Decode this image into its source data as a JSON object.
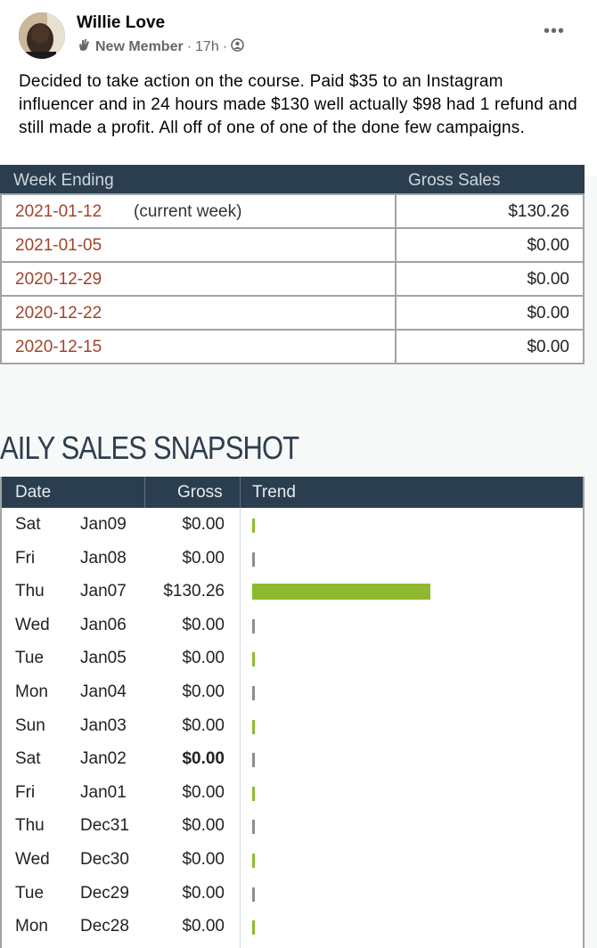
{
  "post": {
    "author": "Willie Love",
    "badge": "New Member",
    "time": "17h",
    "separator": "·",
    "more_label": "•••",
    "text": "Decided to take action on the course. Paid $35 to an Instagram influencer and in 24 hours made $130 well actually $98 had 1 refund and still made a profit. All off of one of one of the done few campaigns."
  },
  "weekly": {
    "headers": [
      "Week Ending",
      "Gross Sales"
    ],
    "rows": [
      {
        "date": "2021-01-12",
        "note": "(current week)",
        "value": "$130.26"
      },
      {
        "date": "2021-01-05",
        "note": "",
        "value": "$0.00"
      },
      {
        "date": "2020-12-29",
        "note": "",
        "value": "$0.00"
      },
      {
        "date": "2020-12-22",
        "note": "",
        "value": "$0.00"
      },
      {
        "date": "2020-12-15",
        "note": "",
        "value": "$0.00"
      }
    ]
  },
  "daily": {
    "title": "AILY SALES SNAPSHOT",
    "headers": [
      "Date",
      "Gross",
      "Trend"
    ],
    "max_value": 130.26,
    "rows": [
      {
        "day": "Sat",
        "date": "Jan09",
        "gross": "$0.00",
        "value": 0,
        "color": "#8fba2f"
      },
      {
        "day": "Fri",
        "date": "Jan08",
        "gross": "$0.00",
        "value": 0,
        "color": "#8e8e8e"
      },
      {
        "day": "Thu",
        "date": "Jan07",
        "gross": "$130.26",
        "value": 130.26,
        "color": "#8fba2f"
      },
      {
        "day": "Wed",
        "date": "Jan06",
        "gross": "$0.00",
        "value": 0,
        "color": "#8e8e8e"
      },
      {
        "day": "Tue",
        "date": "Jan05",
        "gross": "$0.00",
        "value": 0,
        "color": "#8fba2f"
      },
      {
        "day": "Mon",
        "date": "Jan04",
        "gross": "$0.00",
        "value": 0,
        "color": "#8e8e8e"
      },
      {
        "day": "Sun",
        "date": "Jan03",
        "gross": "$0.00",
        "value": 0,
        "color": "#8fba2f"
      },
      {
        "day": "Sat",
        "date": "Jan02",
        "gross": "$0.00",
        "value": 0,
        "color": "#8e8e8e",
        "bold": true
      },
      {
        "day": "Fri",
        "date": "Jan01",
        "gross": "$0.00",
        "value": 0,
        "color": "#8fba2f"
      },
      {
        "day": "Thu",
        "date": "Dec31",
        "gross": "$0.00",
        "value": 0,
        "color": "#8e8e8e"
      },
      {
        "day": "Wed",
        "date": "Dec30",
        "gross": "$0.00",
        "value": 0,
        "color": "#8fba2f"
      },
      {
        "day": "Tue",
        "date": "Dec29",
        "gross": "$0.00",
        "value": 0,
        "color": "#8e8e8e"
      },
      {
        "day": "Mon",
        "date": "Dec28",
        "gross": "$0.00",
        "value": 0,
        "color": "#8fba2f"
      }
    ]
  },
  "icons": {
    "badge_icon": "hand-wave-icon",
    "privacy_icon": "globe-group-icon"
  }
}
